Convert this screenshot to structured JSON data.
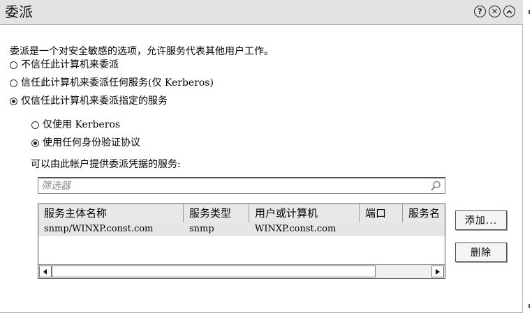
{
  "dialog": {
    "title": "委派",
    "help_symbol": "?",
    "close_symbol": "✕"
  },
  "description": "委派是一个对安全敏感的选项，允许服务代表其他用户工作。",
  "delegation_options": [
    {
      "label": "不信任此计算机来委派",
      "checked": false
    },
    {
      "label": "信任此计算机来委派任何服务(仅 Kerberos)",
      "checked": false
    },
    {
      "label": "仅信任此计算机来委派指定的服务",
      "checked": true
    }
  ],
  "protocol_options": [
    {
      "label": "仅使用 Kerberos",
      "checked": false
    },
    {
      "label": "使用任何身份验证协议",
      "checked": true
    }
  ],
  "services_label": "可以由此帐户提供委派凭据的服务:",
  "filter": {
    "placeholder": "筛选器"
  },
  "table": {
    "columns": [
      "服务主体名称",
      "服务类型",
      "用户或计算机",
      "端口",
      "服务名"
    ],
    "rows": [
      [
        "snmp/WINXP.const.com",
        "snmp",
        "WINXP.const.com",
        "",
        ""
      ]
    ]
  },
  "buttons": {
    "add": "添加...",
    "remove": "删除"
  }
}
